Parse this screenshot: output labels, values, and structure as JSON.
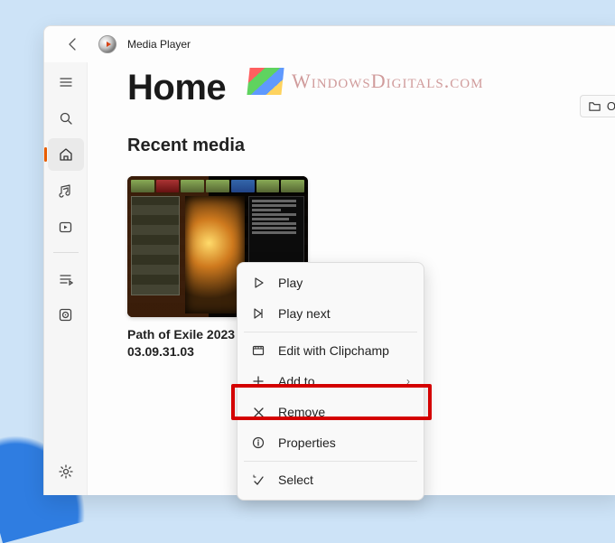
{
  "app": {
    "title": "Media Player"
  },
  "page": {
    "title": "Home"
  },
  "toolbar": {
    "open_label": "O"
  },
  "section": {
    "recent_title": "Recent media"
  },
  "media_items": [
    {
      "title": "Path of Exile 2023 - 03.09.31.03"
    }
  ],
  "context_menu": {
    "play": "Play",
    "play_next": "Play next",
    "edit_clipchamp": "Edit with Clipchamp",
    "add_to": "Add to",
    "remove": "Remove",
    "properties": "Properties",
    "select": "Select"
  },
  "watermark": {
    "text": "WindowsDigitals.com"
  }
}
